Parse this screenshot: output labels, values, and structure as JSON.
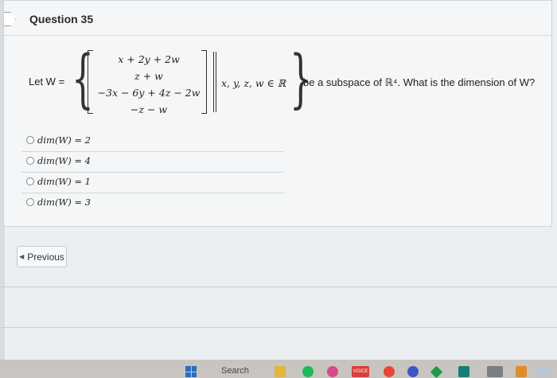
{
  "question": {
    "title": "Question 35",
    "let_label": "Let W =",
    "vector_entries": [
      "x + 2y + 2w",
      "z + w",
      "−3x − 6y + 4z − 2w",
      "−z − w"
    ],
    "condition": "x, y, z, w ∈ ℝ",
    "rest_text": "be a subspace of ℝ⁴. What is the dimension of W?"
  },
  "options": [
    {
      "label": "dim(W) = 2"
    },
    {
      "label": "dim(W) = 4"
    },
    {
      "label": "dim(W) = 1"
    },
    {
      "label": "dim(W) = 3"
    }
  ],
  "nav": {
    "previous_label": "Previous"
  },
  "taskbar": {
    "search_label": "Search",
    "red_badge": "VOICE"
  }
}
